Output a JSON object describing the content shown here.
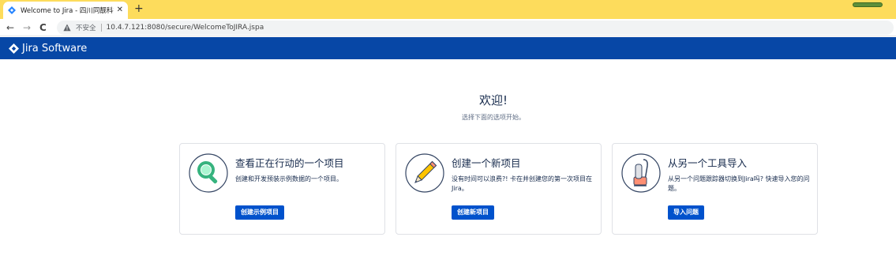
{
  "browser": {
    "tab": {
      "title": "Welcome to Jira - 四川同靓科技",
      "close_glyph": "✕"
    },
    "new_tab_glyph": "+",
    "nav": {
      "back": "←",
      "forward": "→",
      "reload": "C"
    },
    "address": {
      "security_label": "不安全",
      "url": "10.4.7.121:8080/secure/WelcomeToJIRA.jspa"
    }
  },
  "header": {
    "logo_text": "Jira Software"
  },
  "welcome": {
    "title": "欢迎!",
    "subtitle": "选择下面的选项开始。"
  },
  "cards": [
    {
      "title": "查看正在行动的一个项目",
      "description": "创建和开发预装示例数据的一个项目。",
      "button": "创建示例项目",
      "icon": "magnifier-icon"
    },
    {
      "title": "创建一个新项目",
      "description": "没有时间可以浪费?! 卡在并创建您的第一次项目在 Jira。",
      "button": "创建新项目",
      "icon": "pencil-icon"
    },
    {
      "title": "从另一个工具导入",
      "description": "从另一个问题跟踪器切换到Jira吗? 快速导入您的问题。",
      "button": "导入问题",
      "icon": "vacuum-icon"
    }
  ],
  "colors": {
    "tabstrip": "#fddc5c",
    "jira_header": "#0747a6",
    "button": "#0052cc"
  }
}
